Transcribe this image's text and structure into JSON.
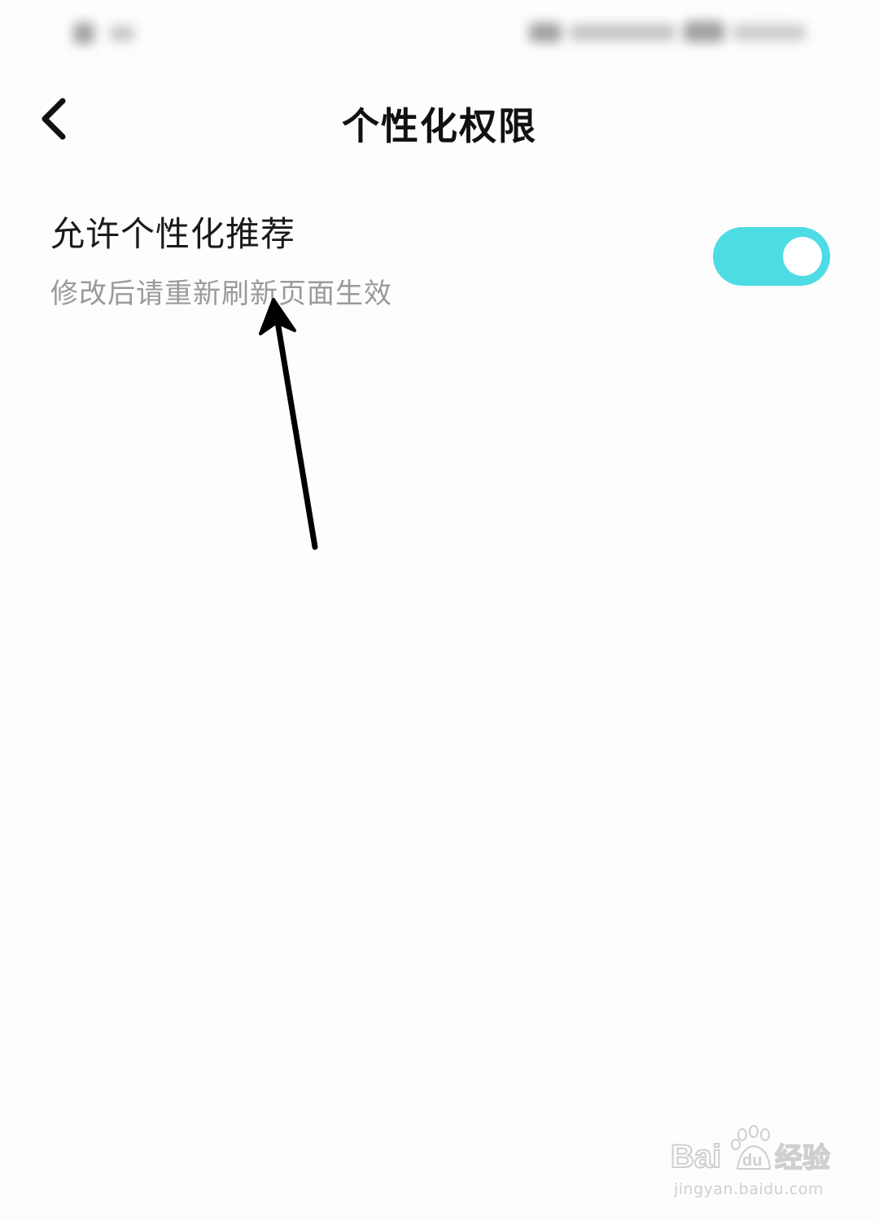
{
  "header": {
    "title": "个性化权限",
    "back_icon": "chevron-left-icon"
  },
  "setting": {
    "title": "允许个性化推荐",
    "subtitle": "修改后请重新刷新页面生效",
    "toggle_on": true,
    "toggle_color": "#4ddbe4"
  },
  "watermark": {
    "brand": "Baidu经验",
    "url": "jingyan.baidu.com"
  }
}
